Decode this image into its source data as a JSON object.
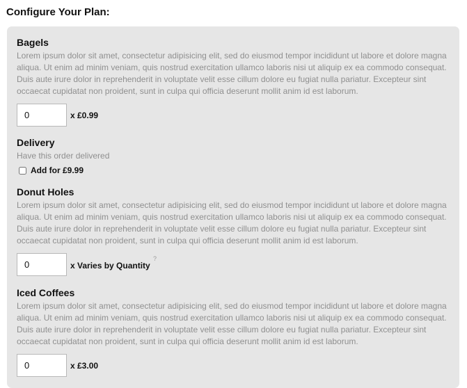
{
  "page": {
    "title": "Configure Your Plan:"
  },
  "lorem": "Lorem ipsum dolor sit amet, consectetur adipisicing elit, sed do eiusmod tempor incididunt ut labore et dolore magna aliqua. Ut enim ad minim veniam, quis nostrud exercitation ullamco laboris nisi ut aliquip ex ea commodo consequat. Duis aute irure dolor in reprehenderit in voluptate velit esse cillum dolore eu fugiat nulla pariatur. Excepteur sint occaecat cupidatat non proident, sunt in culpa qui officia deserunt mollit anim id est laborum.",
  "items": {
    "bagels": {
      "title": "Bagels",
      "quantity": "0",
      "price": "x £0.99"
    },
    "delivery": {
      "title": "Delivery",
      "description": "Have this order delivered",
      "checkbox_label": "Add for £9.99",
      "checked": false
    },
    "donut_holes": {
      "title": "Donut Holes",
      "quantity": "0",
      "price": "x Varies by Quantity",
      "help": "?"
    },
    "iced_coffees": {
      "title": "Iced Coffees",
      "quantity": "0",
      "price": "x £3.00"
    }
  }
}
